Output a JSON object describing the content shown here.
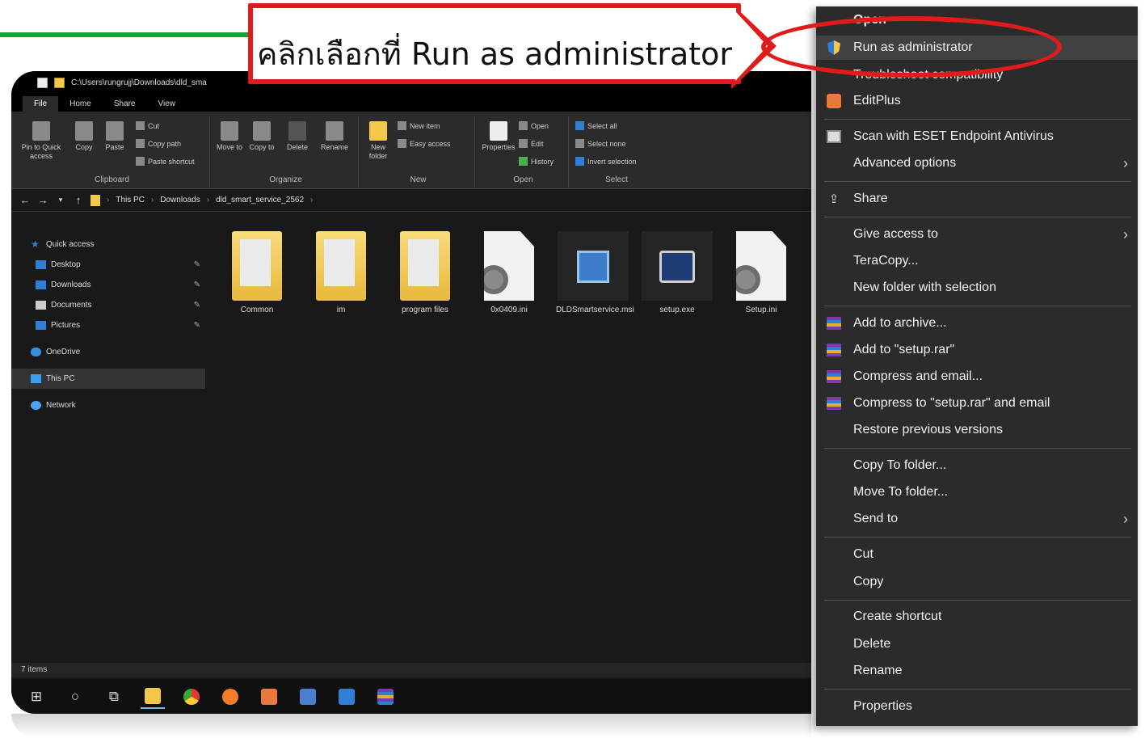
{
  "callout": {
    "text": "คลิกเลือกที่ Run as administrator"
  },
  "explorer": {
    "title_path": "C:\\Users\\rungrujj\\Downloads\\dld_sma",
    "tabs": [
      "File",
      "Home",
      "Share",
      "View"
    ],
    "ribbon": {
      "clipboard": {
        "name": "Clipboard",
        "pin": "Pin to Quick access",
        "copy": "Copy",
        "paste": "Paste",
        "cut": "Cut",
        "copy_path": "Copy path",
        "paste_shortcut": "Paste shortcut"
      },
      "organize": {
        "name": "Organize",
        "move_to": "Move to",
        "copy_to": "Copy to",
        "delete": "Delete",
        "rename": "Rename"
      },
      "new": {
        "name": "New",
        "new_folder": "New folder",
        "new_item": "New item",
        "easy_access": "Easy access"
      },
      "open": {
        "name": "Open",
        "properties": "Properties",
        "open": "Open",
        "edit": "Edit",
        "history": "History"
      },
      "select": {
        "name": "Select",
        "select_all": "Select all",
        "select_none": "Select none",
        "invert": "Invert selection"
      }
    },
    "breadcrumb": [
      "This PC",
      "Downloads",
      "dld_smart_service_2562"
    ],
    "nav": {
      "quick_access": "Quick access",
      "desktop": "Desktop",
      "downloads": "Downloads",
      "documents": "Documents",
      "pictures": "Pictures",
      "onedrive": "OneDrive",
      "this_pc": "This PC",
      "network": "Network"
    },
    "files": [
      {
        "name": "Common"
      },
      {
        "name": "im"
      },
      {
        "name": "program files"
      },
      {
        "name": "0x0409.ini"
      },
      {
        "name": "DLDSmartservice.msi"
      },
      {
        "name": "setup.exe"
      },
      {
        "name": "Setup.ini"
      }
    ],
    "status": "7 items"
  },
  "context_menu": {
    "open": "Open",
    "run_as_admin": "Run as administrator",
    "troubleshoot": "Troubleshoot compatibility",
    "editplus": "EditPlus",
    "eset": "Scan with ESET Endpoint Antivirus",
    "advanced": "Advanced options",
    "share": "Share",
    "give_access": "Give access to",
    "teracopy": "TeraCopy...",
    "new_folder_sel": "New folder with selection",
    "add_archive": "Add to archive...",
    "add_setup_rar": "Add to \"setup.rar\"",
    "compress_email": "Compress and email...",
    "compress_setup_email": "Compress to \"setup.rar\" and email",
    "restore": "Restore previous versions",
    "copy_to_folder": "Copy To folder...",
    "move_to_folder": "Move To folder...",
    "send_to": "Send to",
    "cut": "Cut",
    "copy": "Copy",
    "create_shortcut": "Create shortcut",
    "delete": "Delete",
    "rename": "Rename",
    "properties": "Properties"
  }
}
